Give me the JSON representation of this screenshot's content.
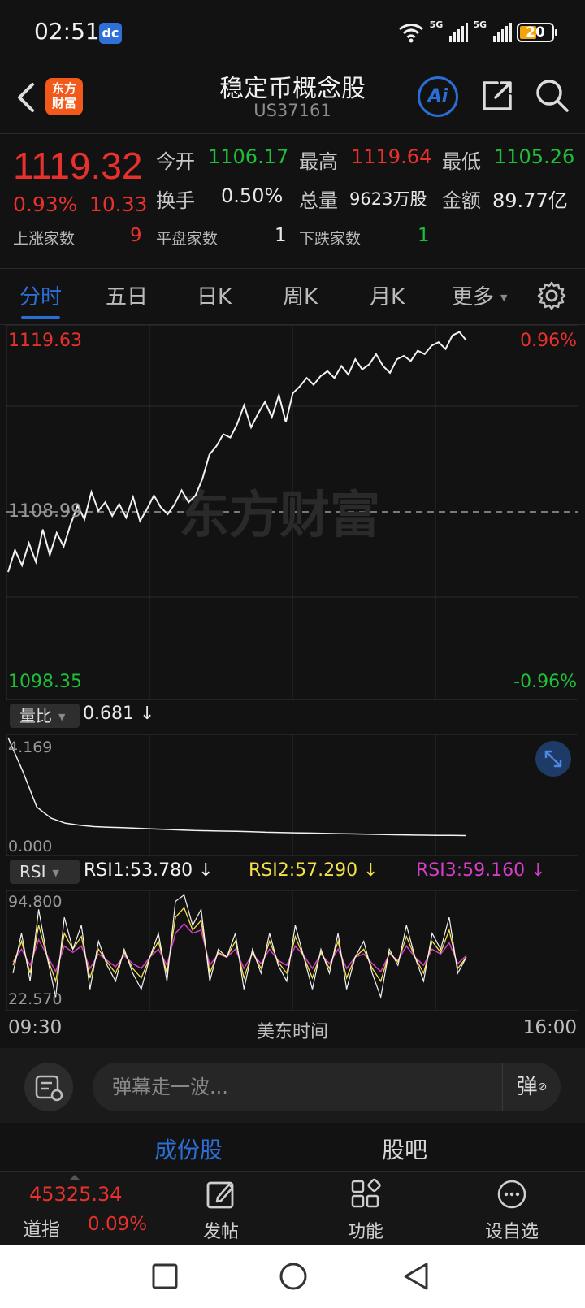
{
  "status_bar": {
    "time": "02:51",
    "app_icon": "dc",
    "net1": "5G",
    "net2": "5G",
    "battery": "20"
  },
  "header": {
    "title": "稳定币概念股",
    "code": "US37161",
    "logo_text_1": "东方",
    "logo_text_2": "财富",
    "ai_label": "Ai"
  },
  "quote": {
    "price": "1119.32",
    "change_pct": "0.93%",
    "change_abs": "10.33",
    "open_label": "今开",
    "open_value": "1106.17",
    "high_label": "最高",
    "high_value": "1119.64",
    "low_label": "最低",
    "low_value": "1105.26",
    "turnover_label": "换手",
    "turnover_value": "0.50%",
    "volume_label": "总量",
    "volume_value": "9623万股",
    "amount_label": "金额",
    "amount_value": "89.77亿",
    "up_label": "上涨家数",
    "up_value": "9",
    "flat_label": "平盘家数",
    "flat_value": "1",
    "down_label": "下跌家数",
    "down_value": "1"
  },
  "tabs": [
    "分时",
    "五日",
    "日K",
    "周K",
    "月K",
    "更多"
  ],
  "active_tab": "分时",
  "chart": {
    "max_label": "1119.63",
    "min_label": "1098.35",
    "ref_label": "1108.99",
    "max_pct": "0.96%",
    "min_pct": "-0.96%",
    "watermark": "东方财富",
    "time_start": "09:30",
    "time_mid": "美东时间",
    "time_end": "16:00"
  },
  "volume_panel": {
    "selector": "量比",
    "value": "0.681",
    "max_label": "4.169",
    "min_label": "0.000"
  },
  "rsi_panel": {
    "selector": "RSI",
    "rsi1": "RSI1:53.780",
    "rsi2": "RSI2:57.290",
    "rsi3": "RSI3:59.160",
    "max_label": "94.800",
    "min_label": "22.570",
    "colors": {
      "rsi1": "#ffffff",
      "rsi2": "#f5e04a",
      "rsi3": "#d43fc8"
    }
  },
  "comment": {
    "placeholder": "弹幕走一波...",
    "danmu_label": "弹"
  },
  "sub_tabs": [
    "成份股",
    "股吧"
  ],
  "active_sub_tab": "成份股",
  "bottom_nav": {
    "index_value": "45325.34",
    "index_name": "道指",
    "index_pct": "0.09%",
    "post_label": "发帖",
    "function_label": "功能",
    "watchlist_label": "设自选"
  },
  "colors": {
    "up": "#e8312c",
    "down": "#1fbf3a",
    "accent": "#2b6fd6",
    "background": "#121212"
  },
  "chart_data": [
    {
      "type": "line",
      "yrange": [
        1098.35,
        1119.63
      ],
      "reference": 1108.99,
      "x_start": "09:30",
      "x_end": "16:00",
      "values": [
        1105.5,
        1106.8,
        1105.9,
        1107.2,
        1106.1,
        1108.0,
        1106.5,
        1107.8,
        1107.0,
        1108.3,
        1109.4,
        1108.6,
        1110.2,
        1109.1,
        1109.6,
        1108.8,
        1109.5,
        1108.7,
        1109.9,
        1108.5,
        1109.2,
        1110.0,
        1109.3,
        1108.9,
        1109.5,
        1110.3,
        1109.6,
        1110.0,
        1111.0,
        1112.4,
        1112.9,
        1113.6,
        1113.4,
        1114.2,
        1115.3,
        1114.0,
        1114.8,
        1115.5,
        1114.6,
        1115.9,
        1114.3,
        1116.0,
        1116.4,
        1116.9,
        1116.5,
        1117.0,
        1117.3,
        1116.9,
        1117.6,
        1117.1,
        1118.0,
        1117.4,
        1117.7,
        1118.3,
        1117.6,
        1117.2,
        1118.0,
        1118.2,
        1117.9,
        1118.5,
        1118.3,
        1118.8,
        1119.0,
        1118.6,
        1119.4,
        1119.6,
        1119.1
      ]
    },
    {
      "type": "line",
      "title": "量比",
      "yrange": [
        0.0,
        4.169
      ],
      "values": [
        4.169,
        3.0,
        1.7,
        1.3,
        1.12,
        1.05,
        1.0,
        0.98,
        0.96,
        0.94,
        0.92,
        0.9,
        0.88,
        0.86,
        0.85,
        0.84,
        0.83,
        0.82,
        0.8,
        0.79,
        0.78,
        0.77,
        0.76,
        0.75,
        0.74,
        0.73,
        0.72,
        0.71,
        0.7,
        0.695,
        0.69,
        0.685,
        0.681
      ]
    },
    {
      "type": "line",
      "title": "RSI",
      "yrange": [
        22.57,
        94.8
      ],
      "series": [
        {
          "name": "RSI1",
          "values": [
            45,
            70,
            40,
            85,
            55,
            30,
            80,
            60,
            75,
            35,
            65,
            50,
            40,
            60,
            45,
            35,
            55,
            70,
            40,
            90,
            94,
            75,
            85,
            40,
            60,
            55,
            70,
            35,
            60,
            45,
            70,
            50,
            40,
            75,
            55,
            35,
            60,
            45,
            70,
            35,
            55,
            65,
            45,
            30,
            60,
            50,
            75,
            55,
            40,
            70,
            60,
            80,
            45,
            55
          ]
        },
        {
          "name": "RSI2",
          "values": [
            50,
            65,
            45,
            75,
            55,
            40,
            70,
            60,
            68,
            42,
            60,
            52,
            45,
            58,
            48,
            42,
            55,
            65,
            45,
            80,
            86,
            72,
            78,
            45,
            58,
            55,
            65,
            42,
            58,
            48,
            65,
            52,
            45,
            68,
            55,
            42,
            58,
            48,
            65,
            42,
            55,
            60,
            48,
            40,
            58,
            52,
            68,
            55,
            45,
            65,
            58,
            72,
            48,
            55
          ]
        },
        {
          "name": "RSI3",
          "values": [
            52,
            60,
            50,
            66,
            56,
            46,
            62,
            58,
            62,
            48,
            57,
            53,
            49,
            56,
            51,
            48,
            55,
            60,
            50,
            70,
            76,
            70,
            72,
            50,
            57,
            55,
            60,
            48,
            57,
            51,
            60,
            53,
            50,
            62,
            56,
            48,
            57,
            51,
            60,
            48,
            55,
            57,
            51,
            46,
            57,
            53,
            62,
            55,
            50,
            60,
            57,
            64,
            51,
            56
          ]
        }
      ]
    }
  ]
}
